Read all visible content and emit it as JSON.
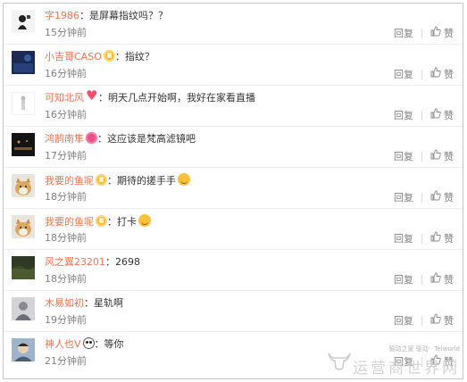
{
  "comments": [
    {
      "name": "字1986",
      "badge": "",
      "colon": "：",
      "text": "是屏幕指纹吗？？",
      "emoji": false,
      "time": "15分钟前",
      "reply": "回复",
      "like": "赞",
      "avatar": "dark-figure-on-white"
    },
    {
      "name": "小吉哥CASO",
      "badge": "vip",
      "colon": "：",
      "text": "指纹？",
      "emoji": false,
      "time": "16分钟前",
      "reply": "回复",
      "like": "赞",
      "avatar": "navy-blue-pattern"
    },
    {
      "name": "可知北风",
      "badge": "heart",
      "colon": "：",
      "text": "明天几点开始啊，我好在家看直播",
      "emoji": false,
      "time": "16分钟前",
      "reply": "回复",
      "like": "赞",
      "avatar": "white-silhouette"
    },
    {
      "name": "鸿鹄南隼",
      "badge": "pink",
      "colon": "：",
      "text": "这应该是梵高滤镜吧",
      "emoji": false,
      "time": "17分钟前",
      "reply": "回复",
      "like": "赞",
      "avatar": "dark-night-scene"
    },
    {
      "name": "我要的鱼呢",
      "badge": "vip",
      "colon": "：",
      "text": "期待的搓手手",
      "emoji": true,
      "time": "18分钟前",
      "reply": "回复",
      "like": "赞",
      "avatar": "shiba-dog"
    },
    {
      "name": "我要的鱼呢",
      "badge": "vip",
      "colon": "：",
      "text": "打卡",
      "emoji": true,
      "time": "18分钟前",
      "reply": "回复",
      "like": "赞",
      "avatar": "shiba-dog"
    },
    {
      "name": "风之翼23201",
      "badge": "",
      "colon": "：",
      "text": "2698",
      "emoji": false,
      "time": "18分钟前",
      "reply": "回复",
      "like": "赞",
      "avatar": "green-landscape"
    },
    {
      "name": "木易如初",
      "badge": "",
      "colon": "：",
      "text": "星轨啊",
      "emoji": false,
      "time": "19分钟前",
      "reply": "回复",
      "like": "赞",
      "avatar": "grey-person"
    },
    {
      "name": "神人也V",
      "badge": "panda",
      "colon": "：",
      "text": "等你",
      "emoji": false,
      "time": "21分钟前",
      "reply": "回复",
      "like": "赞",
      "avatar": "blue-portrait"
    }
  ],
  "colors": {
    "username": "#eb7350",
    "text": "#333333",
    "meta": "#808080"
  },
  "watermark": {
    "small": "驱动之家 驱动 · Telworld",
    "big": "运营商世界网"
  }
}
